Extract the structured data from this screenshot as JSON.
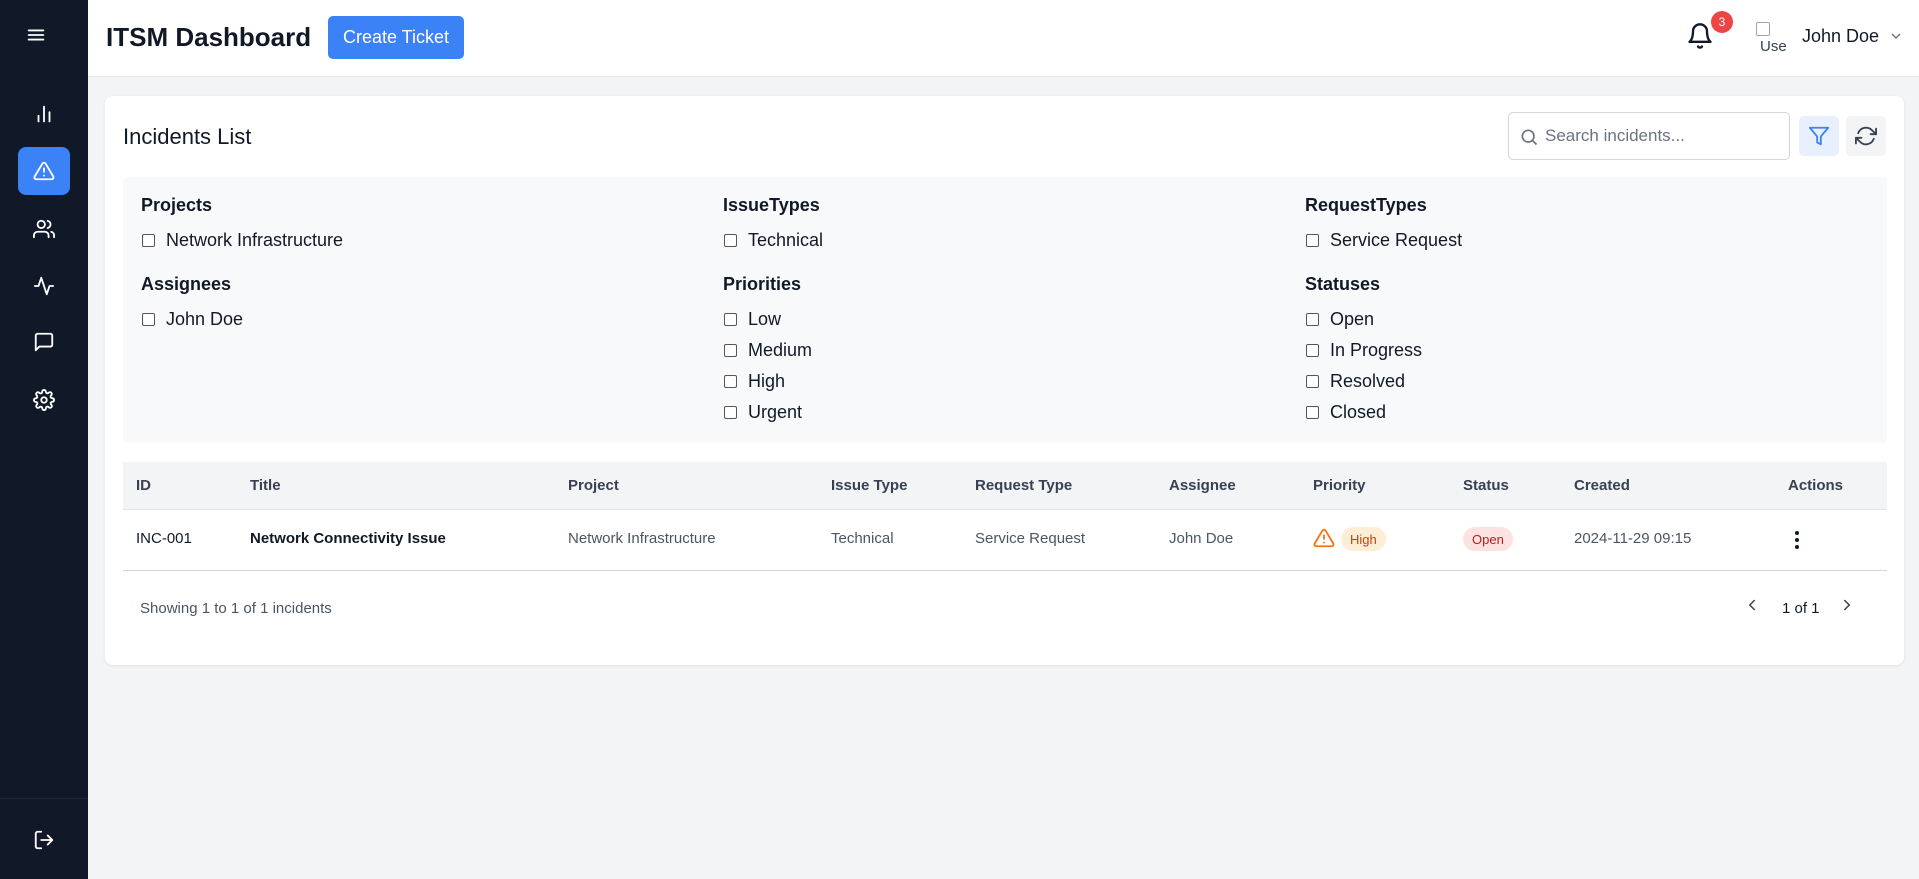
{
  "header": {
    "title": "ITSM Dashboard",
    "create_label": "Create Ticket",
    "notification_count": "3",
    "avatar_alt": "Use",
    "user_name": "John Doe"
  },
  "sidebar": {
    "items": [
      {
        "icon": "bar-chart-icon",
        "active": false
      },
      {
        "icon": "alert-triangle-icon",
        "active": true
      },
      {
        "icon": "users-icon",
        "active": false
      },
      {
        "icon": "activity-icon",
        "active": false
      },
      {
        "icon": "message-icon",
        "active": false
      },
      {
        "icon": "gear-icon",
        "active": false
      }
    ],
    "logout_icon": "logout-icon"
  },
  "incidents": {
    "title": "Incidents List",
    "search_placeholder": "Search incidents...",
    "filters": {
      "projects": {
        "label": "Projects",
        "options": [
          "Network Infrastructure"
        ]
      },
      "issue_types": {
        "label": "IssueTypes",
        "options": [
          "Technical"
        ]
      },
      "request_types": {
        "label": "RequestTypes",
        "options": [
          "Service Request"
        ]
      },
      "assignees": {
        "label": "Assignees",
        "options": [
          "John Doe"
        ]
      },
      "priorities": {
        "label": "Priorities",
        "options": [
          "Low",
          "Medium",
          "High",
          "Urgent"
        ]
      },
      "statuses": {
        "label": "Statuses",
        "options": [
          "Open",
          "In Progress",
          "Resolved",
          "Closed"
        ]
      }
    },
    "columns": [
      "ID",
      "Title",
      "Project",
      "Issue Type",
      "Request Type",
      "Assignee",
      "Priority",
      "Status",
      "Created",
      "Actions"
    ],
    "rows": [
      {
        "id": "INC-001",
        "title": "Network Connectivity Issue",
        "project": "Network Infrastructure",
        "issue_type": "Technical",
        "request_type": "Service Request",
        "assignee": "John Doe",
        "priority": "High",
        "status": "Open",
        "created": "2024-11-29 09:15"
      }
    ],
    "showing_text": "Showing 1 to 1 of 1 incidents",
    "page_label": "1 of 1"
  },
  "colors": {
    "sidebar_bg": "#111827",
    "accent": "#3b82f6",
    "badge": "#ef4444",
    "priority_high_bg": "#ffedd5",
    "priority_high_text": "#c2410c",
    "status_open_bg": "#fee2e2",
    "status_open_text": "#b91c1c",
    "warning_icon": "#f97316"
  }
}
